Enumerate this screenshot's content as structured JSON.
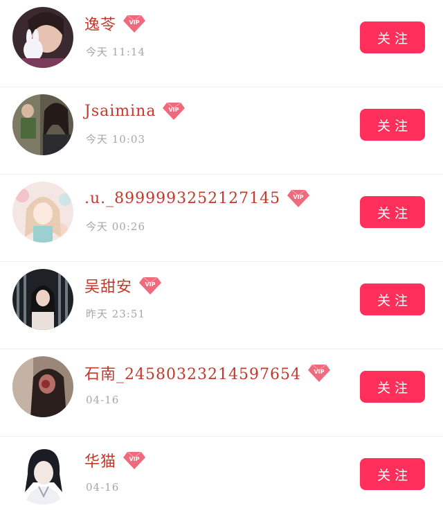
{
  "follow_list": [
    {
      "name": "逸苓",
      "time": "今天 11:14",
      "vip": true,
      "vip_label": "VIP",
      "button": "关注"
    },
    {
      "name": "Jsaimina",
      "time": "今天 10:03",
      "vip": true,
      "vip_label": "VIP",
      "button": "关注"
    },
    {
      "name": ".u._8999993252127145",
      "time": "今天 00:26",
      "vip": true,
      "vip_label": "VIP",
      "button": "关注"
    },
    {
      "name": "吴甜安",
      "time": "昨天 23:51",
      "vip": true,
      "vip_label": "VIP",
      "button": "关注"
    },
    {
      "name": "石南_24580323214597654",
      "time": "04-16",
      "vip": true,
      "vip_label": "VIP",
      "button": "关注"
    },
    {
      "name": "华猫",
      "time": "04-16",
      "vip": true,
      "vip_label": "VIP",
      "button": "关注"
    }
  ],
  "colors": {
    "accent": "#ff2f5b",
    "name_text": "#c0392b",
    "time_text": "#a6a6a6",
    "vip_badge": "#ef6a7c"
  }
}
